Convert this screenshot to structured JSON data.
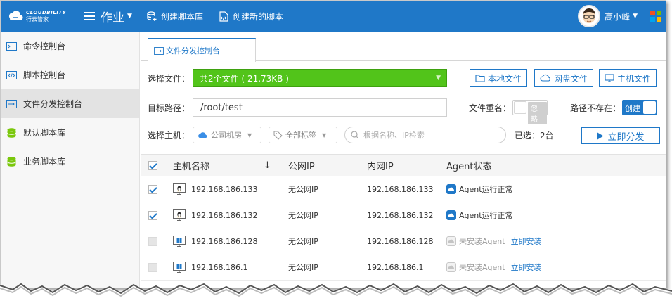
{
  "brand": {
    "name_en": "CLOUDBILITY",
    "name_cn": "行云管家"
  },
  "topbar": {
    "menu_label": "作业",
    "actions": [
      {
        "label": "创建脚本库",
        "icon": "database-plus-icon"
      },
      {
        "label": "创建新的脚本",
        "icon": "script-file-icon"
      }
    ],
    "user_name": "高小峰",
    "colors": {
      "bar": "#1f78c8"
    }
  },
  "sidebar": {
    "items": [
      {
        "label": "命令控制台",
        "icon": "terminal-icon",
        "active": false
      },
      {
        "label": "脚本控制台",
        "icon": "code-icon",
        "active": false
      },
      {
        "label": "文件分发控制台",
        "icon": "file-transfer-icon",
        "active": true
      },
      {
        "label": "默认脚本库",
        "icon": "database-icon",
        "active": false
      },
      {
        "label": "业务脚本库",
        "icon": "database-icon",
        "active": false
      }
    ]
  },
  "tab": {
    "label": "文件分发控制台"
  },
  "form": {
    "select_file_label": "选择文件：",
    "select_file_value": "共2个文件 ( 21.73KB )",
    "local_file_btn": "本地文件",
    "cloud_file_btn": "网盘文件",
    "host_file_btn": "主机文件",
    "target_path_label": "目标路径：",
    "target_path_value": "/root/test",
    "rename_label": "文件重名：",
    "rename_toggle": "忽略",
    "not_exist_label": "路径不存在：",
    "not_exist_toggle": "创建",
    "select_host_label": "选择主机：",
    "datacenter_select": "公司机房",
    "tag_select": "全部标签",
    "search_placeholder": "根据名称、IP检索",
    "selected_text": "已选：2台",
    "distribute_btn": "立即分发"
  },
  "table": {
    "headers": {
      "name": "主机名称",
      "sort": "↓",
      "public_ip": "公网IP",
      "private_ip": "内网IP",
      "agent": "Agent状态"
    },
    "rows": [
      {
        "checked": true,
        "os": "linux",
        "name": "192.168.186.133",
        "public_ip": "无公网IP",
        "private_ip": "192.168.186.133",
        "agent": "Agent运行正常",
        "agent_ok": true,
        "install": ""
      },
      {
        "checked": true,
        "os": "linux",
        "name": "192.168.186.132",
        "public_ip": "无公网IP",
        "private_ip": "192.168.186.132",
        "agent": "Agent运行正常",
        "agent_ok": true,
        "install": ""
      },
      {
        "checked": false,
        "os": "windows",
        "name": "192.168.186.128",
        "public_ip": "无公网IP",
        "private_ip": "192.168.186.128",
        "agent": "未安装Agent",
        "agent_ok": false,
        "install": "立即安装"
      },
      {
        "checked": false,
        "os": "windows",
        "name": "192.168.186.1",
        "public_ip": "无公网IP",
        "private_ip": "192.168.186.1",
        "agent": "未安装Agent",
        "agent_ok": false,
        "install": "立即安装"
      }
    ]
  }
}
